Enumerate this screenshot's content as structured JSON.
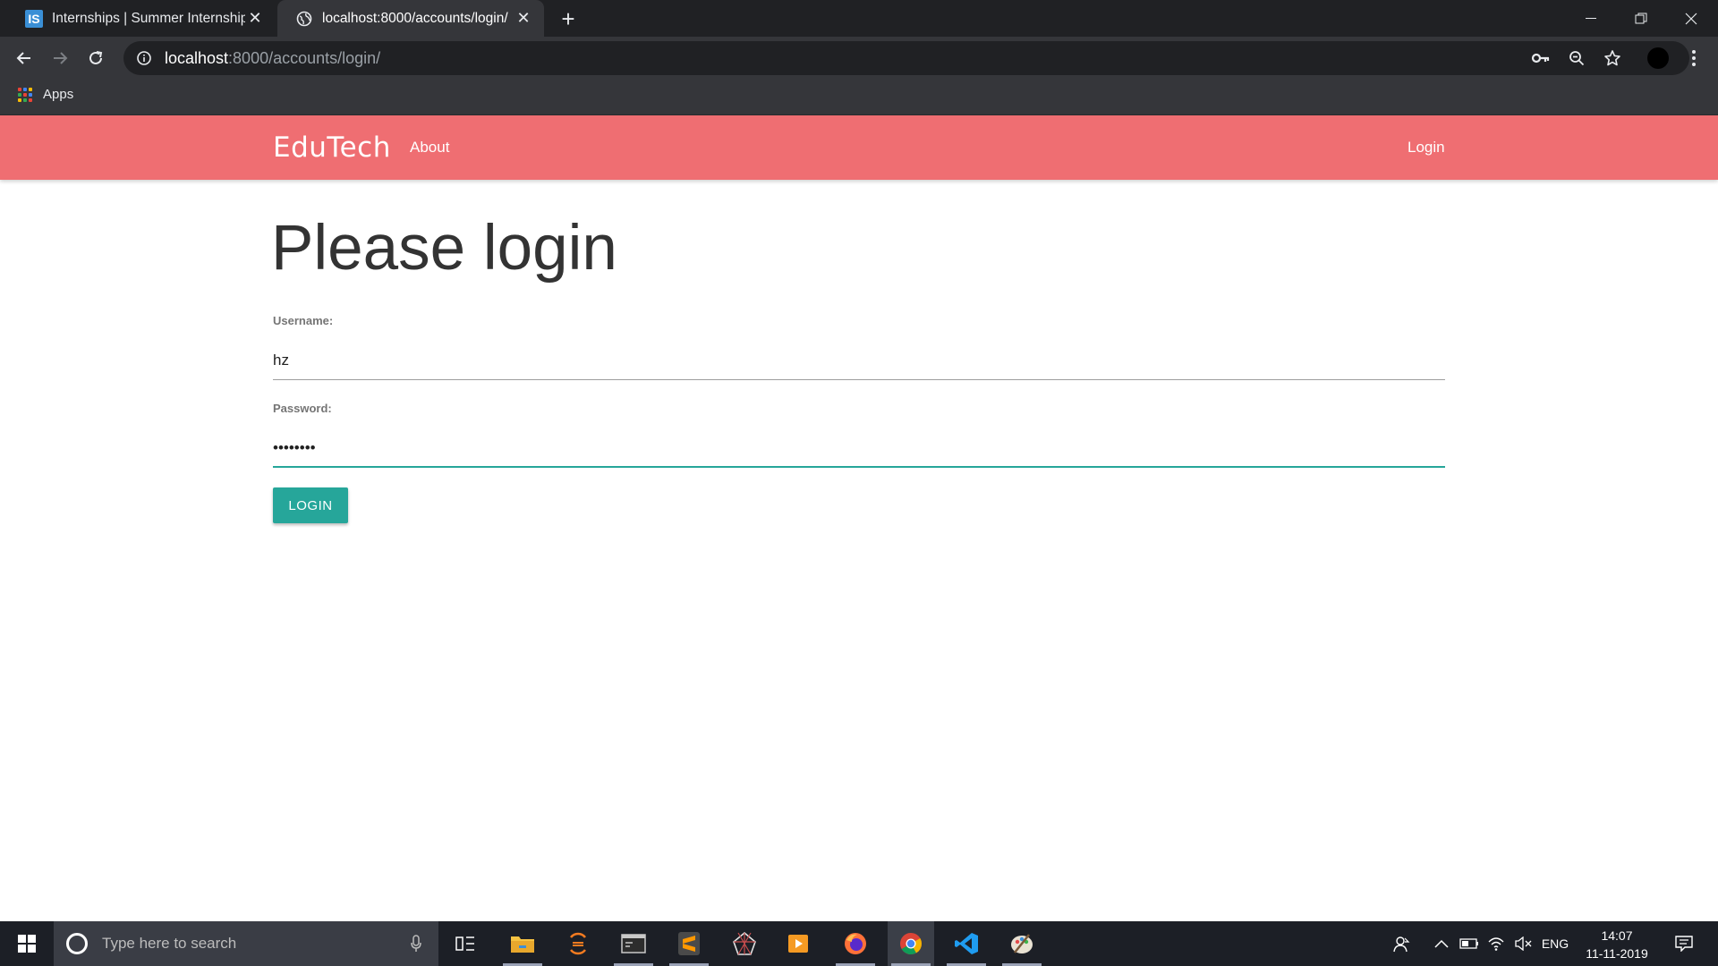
{
  "browser": {
    "tabs": [
      {
        "title": "Internships | Summer Internship |",
        "favicon": "IS"
      },
      {
        "title": "localhost:8000/accounts/login/"
      }
    ],
    "url_host": "localhost",
    "url_rest": ":8000/accounts/login/",
    "bookmarks": {
      "apps_label": "Apps"
    }
  },
  "site": {
    "brand": "EduTech",
    "nav": {
      "about": "About",
      "login": "Login"
    },
    "colors": {
      "navbar": "#ef6e72",
      "accent": "#26a69a"
    }
  },
  "form": {
    "title": "Please login",
    "username_label": "Username:",
    "username_value": "hz",
    "password_label": "Password:",
    "password_value": "••••••••",
    "submit_label": "LOGIN"
  },
  "taskbar": {
    "search_placeholder": "Type here to search",
    "language": "ENG",
    "time": "14:07",
    "date": "11-11-2019",
    "apps": [
      "task-view",
      "file-explorer",
      "eclipse",
      "terminal",
      "sublime-text",
      "spider-app",
      "media-player",
      "firefox",
      "chrome",
      "vscode",
      "paint"
    ]
  }
}
